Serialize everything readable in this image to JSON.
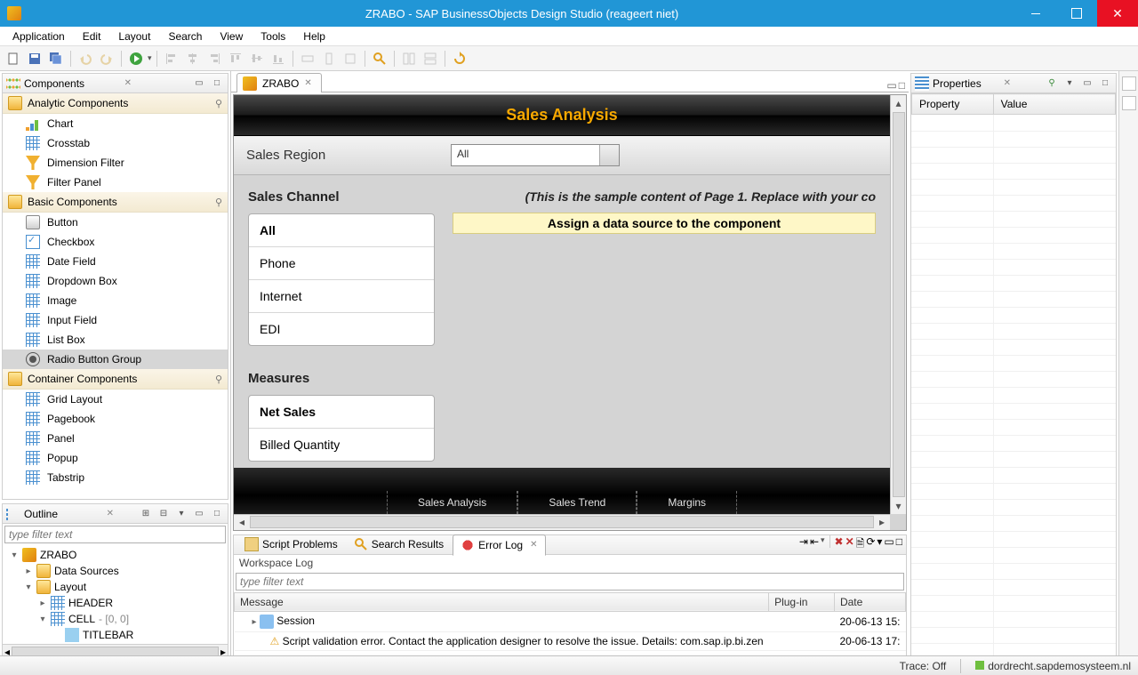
{
  "window_title": "ZRABO - SAP BusinessObjects Design Studio (reageert niet)",
  "menu": [
    "Application",
    "Edit",
    "Layout",
    "Search",
    "View",
    "Tools",
    "Help"
  ],
  "components_panel": {
    "title": "Components",
    "groups": [
      {
        "name": "Analytic Components",
        "items": [
          "Chart",
          "Crosstab",
          "Dimension Filter",
          "Filter Panel"
        ]
      },
      {
        "name": "Basic Components",
        "items": [
          "Button",
          "Checkbox",
          "Date Field",
          "Dropdown Box",
          "Image",
          "Input Field",
          "List Box",
          "Radio Button Group"
        ]
      },
      {
        "name": "Container Components",
        "items": [
          "Grid Layout",
          "Pagebook",
          "Panel",
          "Popup",
          "Tabstrip"
        ]
      }
    ]
  },
  "outline": {
    "title": "Outline",
    "filter_placeholder": "type filter text",
    "root": "ZRABO",
    "children": [
      {
        "label": "Data Sources"
      },
      {
        "label": "Layout",
        "children": [
          {
            "label": "HEADER"
          },
          {
            "label": "CELL",
            "suffix": " - [0, 0]",
            "children": [
              {
                "label": "TITLEBAR"
              }
            ]
          }
        ]
      }
    ]
  },
  "editor_tab": "ZRABO",
  "app_preview": {
    "title": "Sales Analysis",
    "filter_label": "Sales Region",
    "filter_value": "All",
    "channel_label": "Sales Channel",
    "channel_options": [
      "All",
      "Phone",
      "Internet",
      "EDI"
    ],
    "measures_label": "Measures",
    "measures_options": [
      "Net Sales",
      "Billed Quantity"
    ],
    "sample_note": "(This is the sample content of Page 1. Replace with your co",
    "assign_banner": "Assign a data source to the component",
    "footer_tabs": [
      "Sales Analysis",
      "Sales Trend",
      "Margins"
    ]
  },
  "bottom_tabs": {
    "tabs": [
      "Script Problems",
      "Search Results",
      "Error Log"
    ],
    "workspace_label": "Workspace Log",
    "filter_placeholder": "type filter text",
    "columns": [
      "Message",
      "Plug-in",
      "Date"
    ],
    "rows": [
      {
        "msg": "Session",
        "plugin": "",
        "date": "20-06-13 15:"
      },
      {
        "msg": "Script validation error. Contact the application designer to resolve the issue. Details: com.sap.ip.bi.zen",
        "plugin": "",
        "date": "20-06-13 17:"
      }
    ]
  },
  "properties": {
    "title": "Properties",
    "columns": [
      "Property",
      "Value"
    ]
  },
  "status": {
    "trace": "Trace: Off",
    "server": "dordrecht.sapdemosysteem.nl"
  }
}
